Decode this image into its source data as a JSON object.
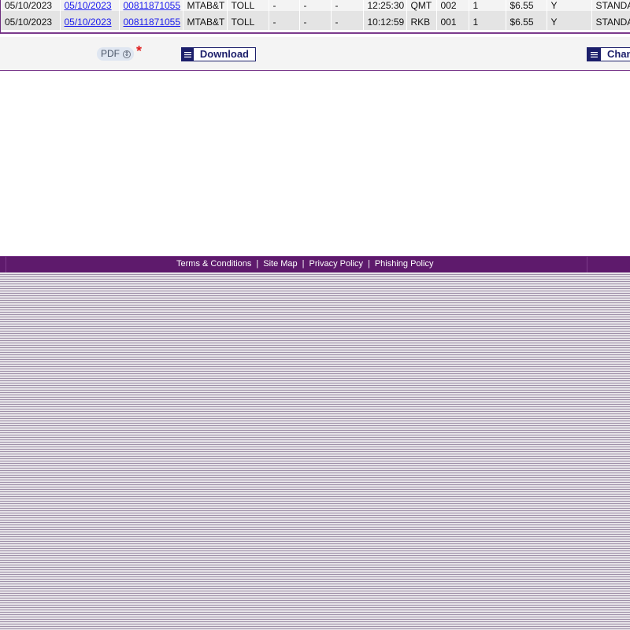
{
  "transactions": [
    {
      "posted_date": "05/10/2023",
      "txn_date": "05/10/2023",
      "tag_number": "00811871055",
      "agency": "MTAB&T",
      "type": "TOLL",
      "c1": "-",
      "c2": "-",
      "c3": "-",
      "time": "12:25:30",
      "plaza": "QMT",
      "lane": "002",
      "cls": "1",
      "amount": "$6.55",
      "flag": "Y",
      "plan": "STANDA"
    },
    {
      "posted_date": "05/10/2023",
      "txn_date": "05/10/2023",
      "tag_number": "00811871055",
      "agency": "MTAB&T",
      "type": "TOLL",
      "c1": "-",
      "c2": "-",
      "c3": "-",
      "time": "10:12:59",
      "plaza": "RKB",
      "lane": "001",
      "cls": "1",
      "amount": "$6.55",
      "flag": "Y",
      "plan": "STANDA"
    }
  ],
  "actions": {
    "format_selected": "PDF",
    "required_marker": "*",
    "download_label": "Download",
    "change_label": "Chan"
  },
  "footer": {
    "links": [
      "Terms & Conditions",
      "Site Map",
      "Privacy Policy",
      "Phishing Policy"
    ],
    "separator": "|"
  },
  "colors": {
    "brand_purple": "#5e1a6c",
    "button_navy": "#1c1f6b",
    "link_blue": "#1a1aee",
    "required_red": "#e02020"
  }
}
